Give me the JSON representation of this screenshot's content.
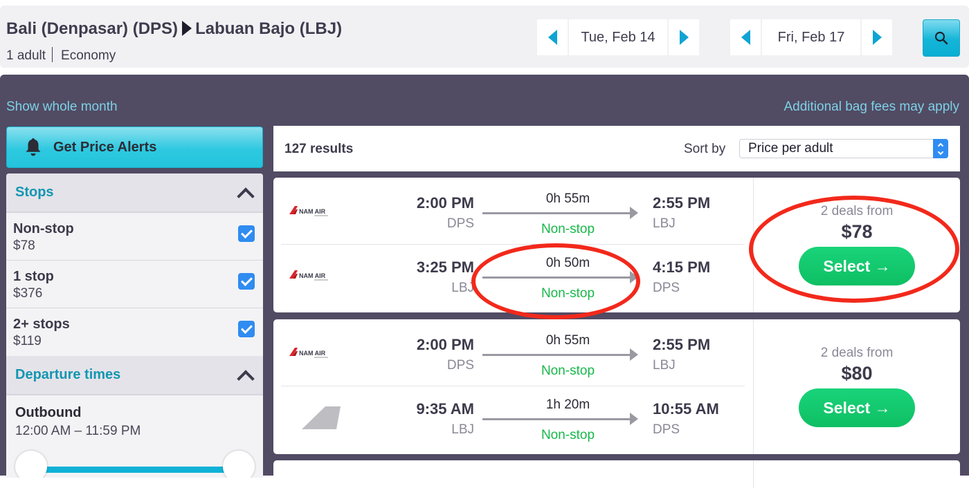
{
  "header": {
    "origin": "Bali (Denpasar) (DPS)",
    "destination": "Labuan Bajo (LBJ)",
    "passengers": "1 adult",
    "cabin": "Economy",
    "depart_date": "Tue, Feb 14",
    "return_date": "Fri, Feb 17",
    "search_icon": "search-icon"
  },
  "links": {
    "show_whole_month": "Show whole month",
    "bag_fees": "Additional bag fees may apply"
  },
  "sidebar": {
    "price_alerts_label": "Get Price Alerts",
    "stops_title": "Stops",
    "stops": [
      {
        "label": "Non-stop",
        "price": "$78",
        "checked": true
      },
      {
        "label": "1 stop",
        "price": "$376",
        "checked": true
      },
      {
        "label": "2+ stops",
        "price": "$119",
        "checked": true
      }
    ],
    "departure_title": "Departure times",
    "outbound_label": "Outbound",
    "outbound_range": "12:00 AM – 11:59 PM"
  },
  "results": {
    "count": "127 results",
    "sort_label": "Sort by",
    "sort_value": "Price per adult",
    "cards": [
      {
        "legs": [
          {
            "airline": "NAM AIR",
            "dep_time": "2:00 PM",
            "dep_code": "DPS",
            "duration": "0h 55m",
            "stops": "Non-stop",
            "arr_time": "2:55 PM",
            "arr_code": "LBJ"
          },
          {
            "airline": "NAM AIR",
            "dep_time": "3:25 PM",
            "dep_code": "LBJ",
            "duration": "0h 50m",
            "stops": "Non-stop",
            "arr_time": "4:15 PM",
            "arr_code": "DPS"
          }
        ],
        "deals": "2 deals from",
        "price": "$78",
        "select_label": "Select →"
      },
      {
        "legs": [
          {
            "airline": "NAM AIR",
            "dep_time": "2:00 PM",
            "dep_code": "DPS",
            "duration": "0h 55m",
            "stops": "Non-stop",
            "arr_time": "2:55 PM",
            "arr_code": "LBJ"
          },
          {
            "airline": "generic",
            "dep_time": "9:35 AM",
            "dep_code": "LBJ",
            "duration": "1h 20m",
            "stops": "Non-stop",
            "arr_time": "10:55 AM",
            "arr_code": "DPS"
          }
        ],
        "deals": "2 deals from",
        "price": "$80",
        "select_label": "Select →"
      }
    ]
  },
  "colors": {
    "accent": "#0fa4d3",
    "panel": "#524b64",
    "green": "#18b84a",
    "annotation": "#f2291b"
  }
}
